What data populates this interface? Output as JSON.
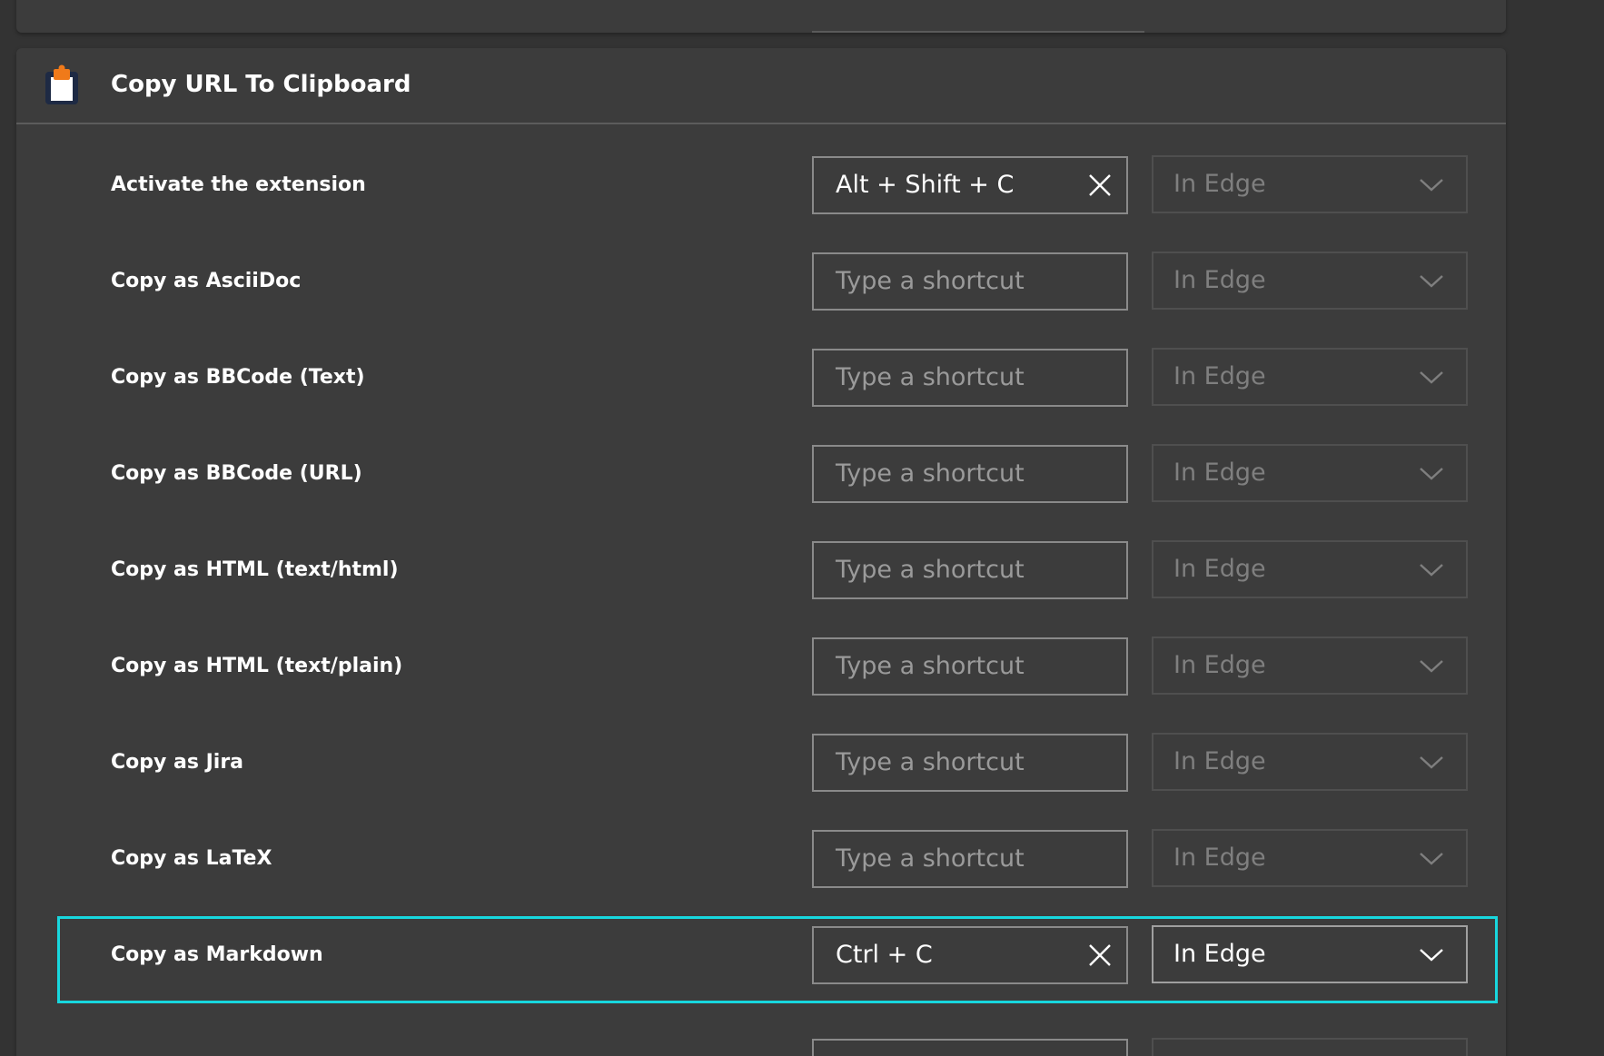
{
  "extension": {
    "name": "Copy URL To Clipboard",
    "icon": "clipboard-icon"
  },
  "colors": {
    "background": "#333333",
    "card": "#3c3c3c",
    "focus_ring": "#18d7de",
    "icon_body": "#1e2a44",
    "icon_clip": "#f07a1a"
  },
  "rows": [
    {
      "label": "Activate the extension",
      "shortcut": "Alt + Shift + C",
      "placeholder": "",
      "scope": "In Edge"
    },
    {
      "label": "Copy as AsciiDoc",
      "shortcut": "",
      "placeholder": "Type a shortcut",
      "scope": "In Edge"
    },
    {
      "label": "Copy as BBCode (Text)",
      "shortcut": "",
      "placeholder": "Type a shortcut",
      "scope": "In Edge"
    },
    {
      "label": "Copy as BBCode (URL)",
      "shortcut": "",
      "placeholder": "Type a shortcut",
      "scope": "In Edge"
    },
    {
      "label": "Copy as HTML (text/html)",
      "shortcut": "",
      "placeholder": "Type a shortcut",
      "scope": "In Edge"
    },
    {
      "label": "Copy as HTML (text/plain)",
      "shortcut": "",
      "placeholder": "Type a shortcut",
      "scope": "In Edge"
    },
    {
      "label": "Copy as Jira",
      "shortcut": "",
      "placeholder": "Type a shortcut",
      "scope": "In Edge"
    },
    {
      "label": "Copy as LaTeX",
      "shortcut": "",
      "placeholder": "Type a shortcut",
      "scope": "In Edge"
    },
    {
      "label": "Copy as Markdown",
      "shortcut": "Ctrl + C",
      "placeholder": "",
      "scope": "In Edge"
    }
  ]
}
